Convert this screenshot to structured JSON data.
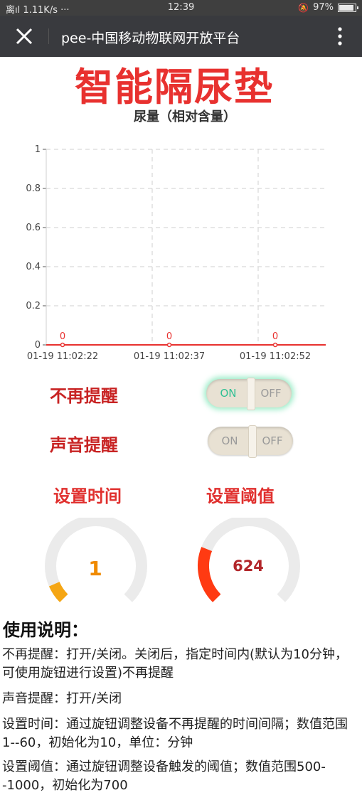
{
  "status_bar": {
    "left": "离ıl 1.11K/s ···",
    "time": "12:39",
    "battery": "97%"
  },
  "navbar": {
    "title": "pee-中国移动物联网开放平台"
  },
  "page": {
    "title": "智能隔尿垫",
    "chart_title": "尿量（相对含量）"
  },
  "chart_data": {
    "type": "line",
    "title": "尿量（相对含量）",
    "x": [
      "01-19 11:02:22",
      "01-19 11:02:37",
      "01-19 11:02:52"
    ],
    "series": [
      {
        "values": [
          0,
          0,
          0
        ],
        "color": "#e8312f"
      }
    ],
    "ylim": [
      0,
      1
    ],
    "yticks": [
      "0",
      "0.2",
      "0.4",
      "0.6",
      "0.8",
      "1"
    ],
    "data_labels": [
      "0",
      "0",
      "0"
    ],
    "grid": true
  },
  "controls": {
    "no_remind_label": "不再提醒",
    "sound_remind_label": "声音提醒",
    "on_text": "ON",
    "off_text": "OFF",
    "no_remind_state": "on",
    "sound_remind_state": "off"
  },
  "settings": {
    "time_label": "设置时间",
    "threshold_label": "设置阈值",
    "time_value": "1",
    "threshold_value": "624",
    "time_fraction": 0.0,
    "threshold_fraction": 0.248,
    "time_color": "#f5a614",
    "threshold_color": "#ff3a12",
    "time_text_color": "#f08a00",
    "threshold_text_color": "#b2262a"
  },
  "instructions": {
    "title": "使用说明：",
    "line1": "不再提醒：打开/关闭。关闭后，指定时间内(默认为10分钟，可使用旋钮进行设置)不再提醒",
    "line2": "声音提醒：打开/关闭",
    "line3": "设置时间：通过旋钮调整设备不再提醒的时间间隔；数值范围1--60，初始化为10，单位：分钟",
    "line4": "设置阈值：通过旋钮调整设备触发的阈值；数值范围500--1000，初始化为700"
  }
}
